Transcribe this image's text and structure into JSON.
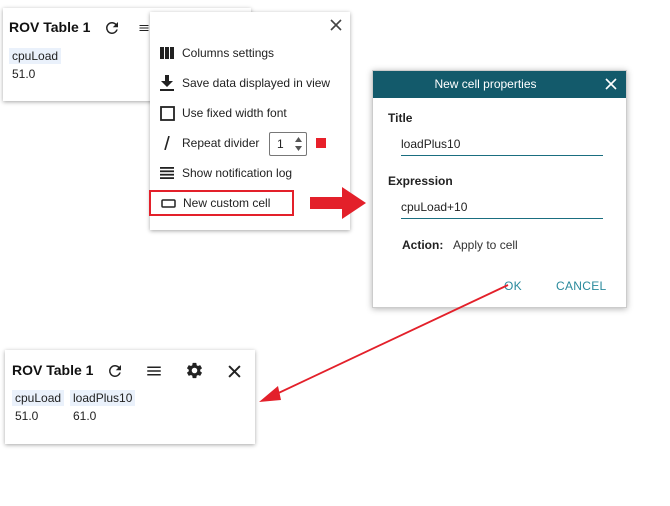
{
  "table1": {
    "title": "ROV Table 1",
    "column": "cpuLoad",
    "value": "51.0"
  },
  "menu": {
    "items": [
      {
        "label": "Columns settings",
        "icon": "columns-icon"
      },
      {
        "label": "Save data displayed in view",
        "icon": "download-icon"
      },
      {
        "label": "Use fixed width font",
        "icon": "checkbox-icon"
      },
      {
        "label": "Repeat divider",
        "icon": "slash-icon"
      },
      {
        "label": "Show notification log",
        "icon": "list-icon"
      },
      {
        "label": "New custom cell",
        "icon": "rectangle-icon"
      }
    ],
    "repeat_divider_value": "1",
    "highlight_color": "#e8202a"
  },
  "dialog": {
    "title": "New cell properties",
    "title_label": "Title",
    "title_value": "loadPlus10",
    "expression_label": "Expression",
    "expression_value": "cpuLoad+10",
    "action_label": "Action:",
    "action_value": "Apply to cell",
    "ok_label": "OK",
    "cancel_label": "CANCEL",
    "header_color": "#135a6b"
  },
  "table2": {
    "title": "ROV Table 1",
    "columns": [
      "cpuLoad",
      "loadPlus10"
    ],
    "values": [
      "51.0",
      "61.0"
    ]
  },
  "colors": {
    "arrow": "#e3202a",
    "cell_header_bg": "#eaf1fb"
  }
}
